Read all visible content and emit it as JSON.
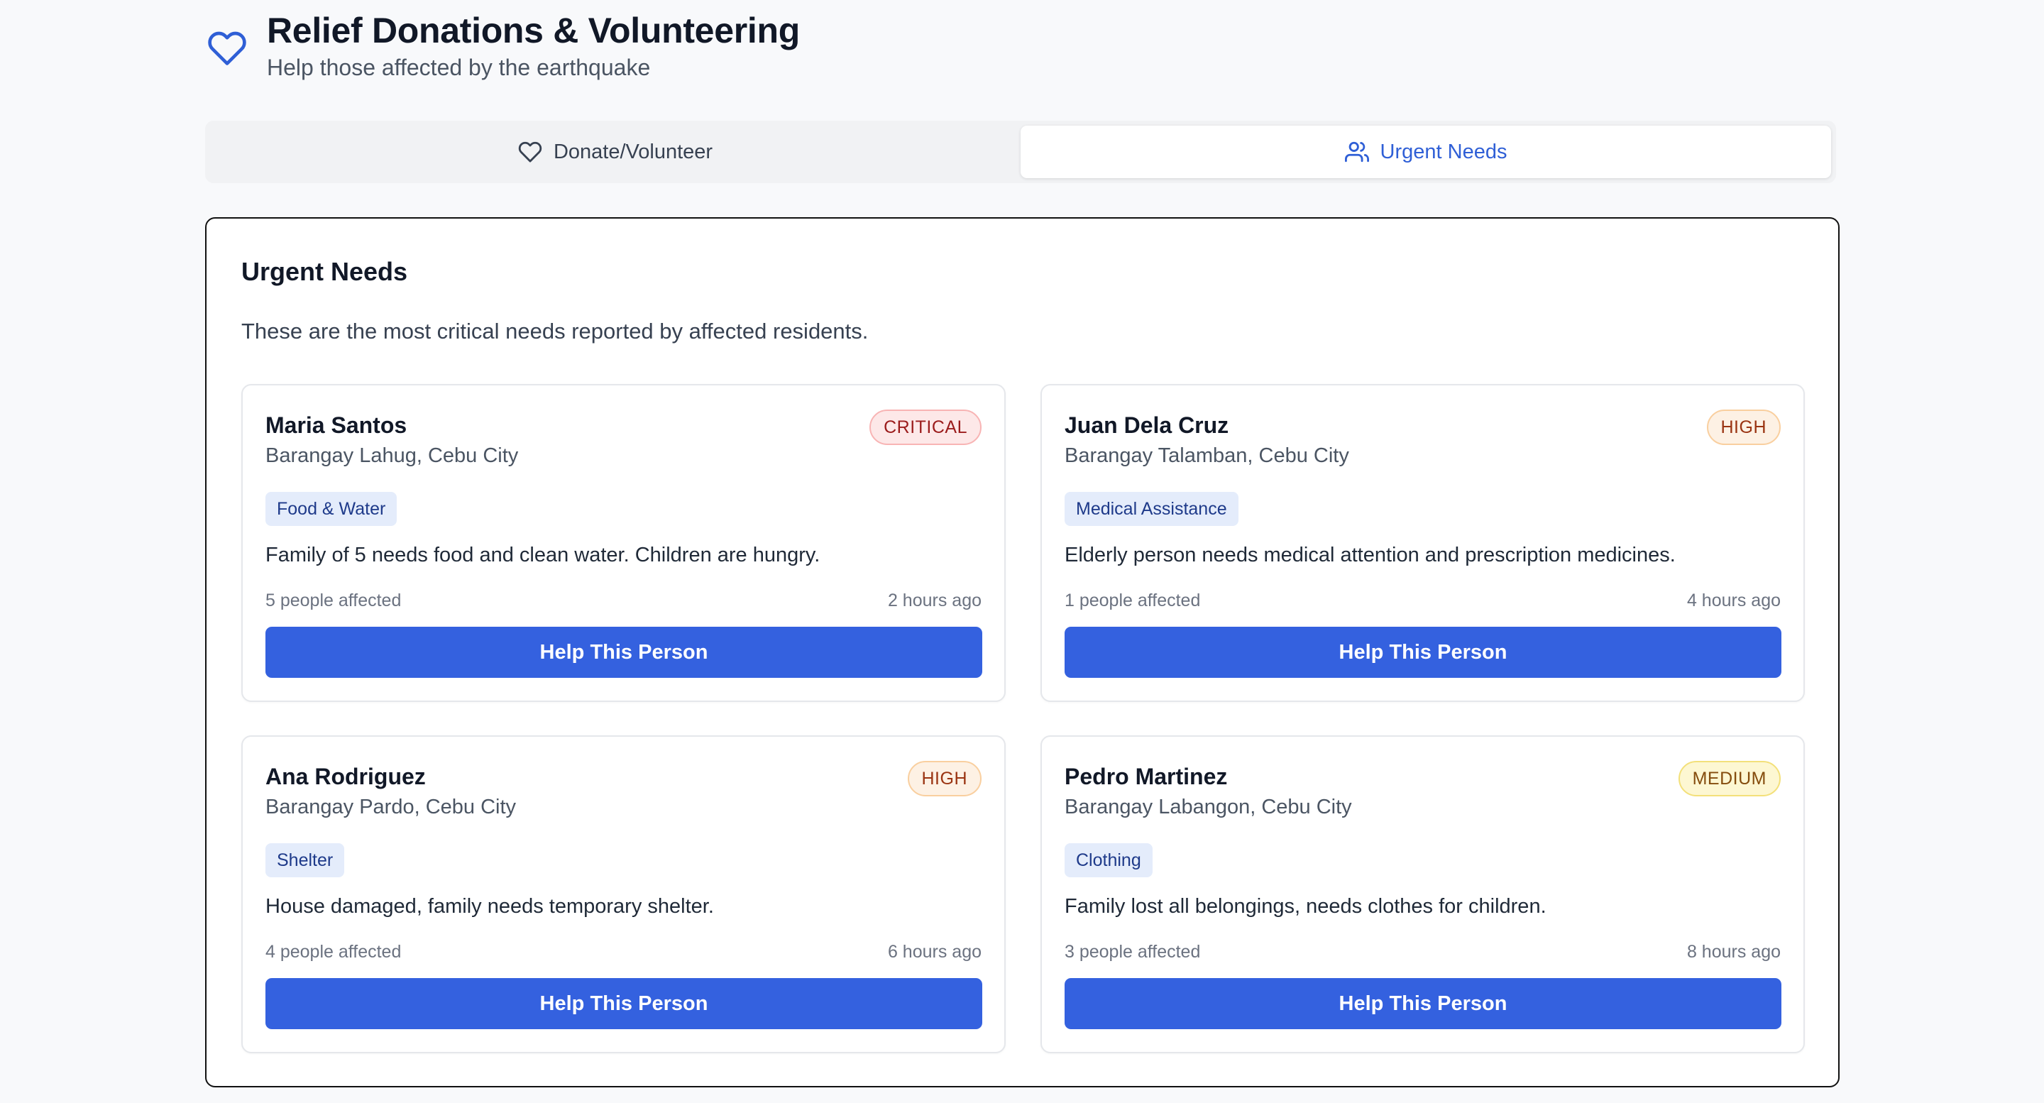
{
  "header": {
    "title": "Relief Donations & Volunteering",
    "subtitle": "Help those affected by the earthquake",
    "icon": "heart-icon",
    "icon_color": "#2f5fd6"
  },
  "tabs": [
    {
      "label": "Donate/Volunteer",
      "icon": "heart-icon",
      "active": false
    },
    {
      "label": "Urgent Needs",
      "icon": "users-icon",
      "active": true
    }
  ],
  "panel": {
    "title": "Urgent Needs",
    "description": "These are the most critical needs reported by affected residents."
  },
  "needs": [
    {
      "name": "Maria Santos",
      "location": "Barangay Lahug, Cebu City",
      "priority": "CRITICAL",
      "category": "Food & Water",
      "description": "Family of 5 needs food and clean water. Children are hungry.",
      "people": "5 people affected",
      "time": "2 hours ago",
      "button": "Help This Person"
    },
    {
      "name": "Juan Dela Cruz",
      "location": "Barangay Talamban, Cebu City",
      "priority": "HIGH",
      "category": "Medical Assistance",
      "description": "Elderly person needs medical attention and prescription medicines.",
      "people": "1 people affected",
      "time": "4 hours ago",
      "button": "Help This Person"
    },
    {
      "name": "Ana Rodriguez",
      "location": "Barangay Pardo, Cebu City",
      "priority": "HIGH",
      "category": "Shelter",
      "description": "House damaged, family needs temporary shelter.",
      "people": "4 people affected",
      "time": "6 hours ago",
      "button": "Help This Person"
    },
    {
      "name": "Pedro Martinez",
      "location": "Barangay Labangon, Cebu City",
      "priority": "MEDIUM",
      "category": "Clothing",
      "description": "Family lost all belongings, needs clothes for children.",
      "people": "3 people affected",
      "time": "8 hours ago",
      "button": "Help This Person"
    }
  ],
  "colors": {
    "primary": "#3461df",
    "critical": "#9b1c1c",
    "high": "#9a3412",
    "medium": "#854d0e"
  }
}
